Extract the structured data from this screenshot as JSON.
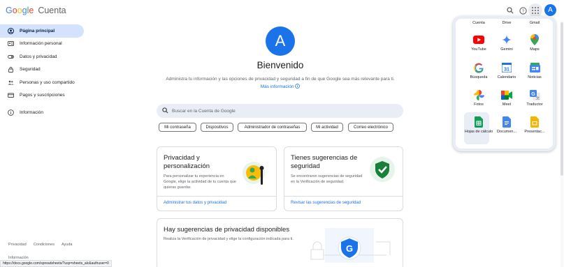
{
  "header": {
    "logo_letters": [
      "G",
      "o",
      "o",
      "g",
      "l",
      "e"
    ],
    "product": "Cuenta",
    "avatar_letter": "A"
  },
  "sidebar": {
    "items": [
      {
        "label": "Página principal",
        "icon": "account-circle-icon"
      },
      {
        "label": "Información personal",
        "icon": "id-card-icon"
      },
      {
        "label": "Datos y privacidad",
        "icon": "toggle-icon"
      },
      {
        "label": "Seguridad",
        "icon": "lock-icon"
      },
      {
        "label": "Personas y uso compartido",
        "icon": "people-icon"
      },
      {
        "label": "Pagos y suscripciones",
        "icon": "credit-card-icon"
      },
      {
        "label": "Información",
        "icon": "info-icon"
      }
    ],
    "footer": [
      "Privacidad",
      "Condiciones",
      "Ayuda"
    ],
    "footer_behind": "Información",
    "status_url": "https://docs.google.com/spreadsheets/?usp=sheets_alc&authuser=0"
  },
  "main": {
    "avatar_letter": "A",
    "welcome": "Bienvenido",
    "subtitle": "Administra tu información y las opciones de privacidad y seguridad a fin de que Google sea más relevante para ti.",
    "more_info": "Más información",
    "search_placeholder": "Buscar en la Cuenta de Google",
    "chips": [
      "Mi contraseña",
      "Dispositivos",
      "Administrador de contraseñas",
      "Mi actividad",
      "Correo electrónico"
    ],
    "cards": [
      {
        "title": "Privacidad y personalización",
        "desc": "Para personalizar tu experiencia en Google, elige la actividad de tu cuenta que quieras guardar.",
        "link": "Administrar tus datos y privacidad"
      },
      {
        "title": "Tienes sugerencias de seguridad",
        "desc": "Se encontraron sugerencias de seguridad en la Verificación de seguridad.",
        "link": "Revisar las sugerencias de seguridad"
      },
      {
        "title": "Hay sugerencias de privacidad disponibles",
        "desc": "Realiza la Verificación de privacidad y elige la configuración indicada para ti."
      }
    ]
  },
  "apps_panel": {
    "top_row": [
      "Cuenta",
      "Drive",
      "Gmail"
    ],
    "apps": [
      {
        "label": "YouTube",
        "icon": "youtube-icon",
        "color": "#ff0000"
      },
      {
        "label": "Gemini",
        "icon": "gemini-icon",
        "color": "#4285f4"
      },
      {
        "label": "Maps",
        "icon": "maps-icon",
        "color": "#34a853"
      },
      {
        "label": "Búsqueda",
        "icon": "google-search-icon",
        "color": "#4285f4"
      },
      {
        "label": "Calendario",
        "icon": "calendar-icon",
        "color": "#1a73e8"
      },
      {
        "label": "Noticias",
        "icon": "news-icon",
        "color": "#4285f4"
      },
      {
        "label": "Fotos",
        "icon": "photos-icon",
        "color": "#fbbc05"
      },
      {
        "label": "Meet",
        "icon": "meet-icon",
        "color": "#00897b"
      },
      {
        "label": "Traductor",
        "icon": "translate-icon",
        "color": "#4285f4"
      },
      {
        "label": "Hojas de cálculo",
        "icon": "sheets-icon",
        "color": "#0f9d58"
      },
      {
        "label": "Documen...",
        "icon": "docs-icon",
        "color": "#4285f4"
      },
      {
        "label": "Presentac...",
        "icon": "slides-icon",
        "color": "#f4b400"
      }
    ]
  },
  "colors": {
    "accent": "#1a73e8",
    "active_nav_bg": "#d3e3fd",
    "search_bg": "#e9eef6"
  }
}
